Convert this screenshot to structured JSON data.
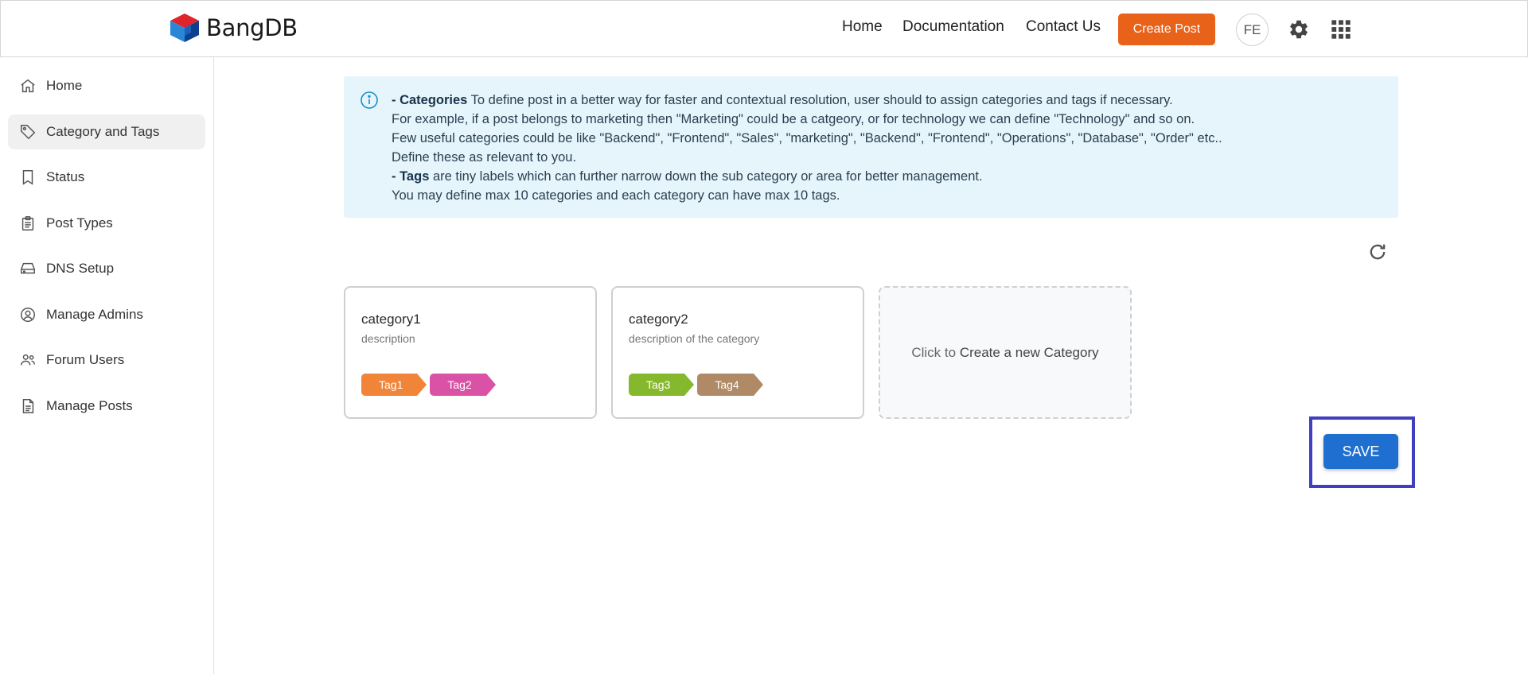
{
  "brand": {
    "name": "BangDB"
  },
  "topnav": {
    "home": "Home",
    "documentation": "Documentation",
    "contact": "Contact Us",
    "create_post": "Create Post",
    "avatar": "FE"
  },
  "sidebar": {
    "items": [
      {
        "label": "Home",
        "icon": "home-icon"
      },
      {
        "label": "Category and Tags",
        "icon": "tag-icon",
        "active": true
      },
      {
        "label": "Status",
        "icon": "bookmark-icon"
      },
      {
        "label": "Post Types",
        "icon": "clipboard-icon"
      },
      {
        "label": "DNS Setup",
        "icon": "server-icon"
      },
      {
        "label": "Manage Admins",
        "icon": "user-circle-icon"
      },
      {
        "label": "Forum Users",
        "icon": "users-icon"
      },
      {
        "label": "Manage Posts",
        "icon": "document-icon"
      }
    ]
  },
  "info": {
    "cat_bold": "- Categories",
    "cat_text": " To define post in a better way for faster and contextual resolution, user should to assign categories and tags if necessary.",
    "line2": "For example, if a post belongs to marketing then \"Marketing\" could be a catgeory, or for technology we can define \"Technology\" and so on.",
    "line3": "Few useful categories could be like \"Backend\", \"Frontend\", \"Sales\", \"marketing\", \"Backend\", \"Frontend\", \"Operations\", \"Database\", \"Order\" etc..",
    "line4": "Define these as relevant to you.",
    "tags_bold": "- Tags",
    "tags_text": " are tiny labels which can further narrow down the sub category or area for better management.",
    "line6": "You may define max 10 categories and each category can have max 10 tags."
  },
  "categories": [
    {
      "title": "category1",
      "description": "description",
      "tags": [
        {
          "label": "Tag1",
          "color": "#f0853a"
        },
        {
          "label": "Tag2",
          "color": "#d952a6"
        }
      ]
    },
    {
      "title": "category2",
      "description": "description of the category",
      "tags": [
        {
          "label": "Tag3",
          "color": "#86b82e"
        },
        {
          "label": "Tag4",
          "color": "#b08a66"
        }
      ]
    }
  ],
  "new_category": {
    "prefix": "Click to ",
    "action": "Create a new Category"
  },
  "save_label": "SAVE",
  "colors": {
    "accent_orange": "#e8621a",
    "save_blue": "#1e6fd0",
    "info_bg": "#e5f5fb",
    "highlight_frame": "#3f3fbf"
  }
}
